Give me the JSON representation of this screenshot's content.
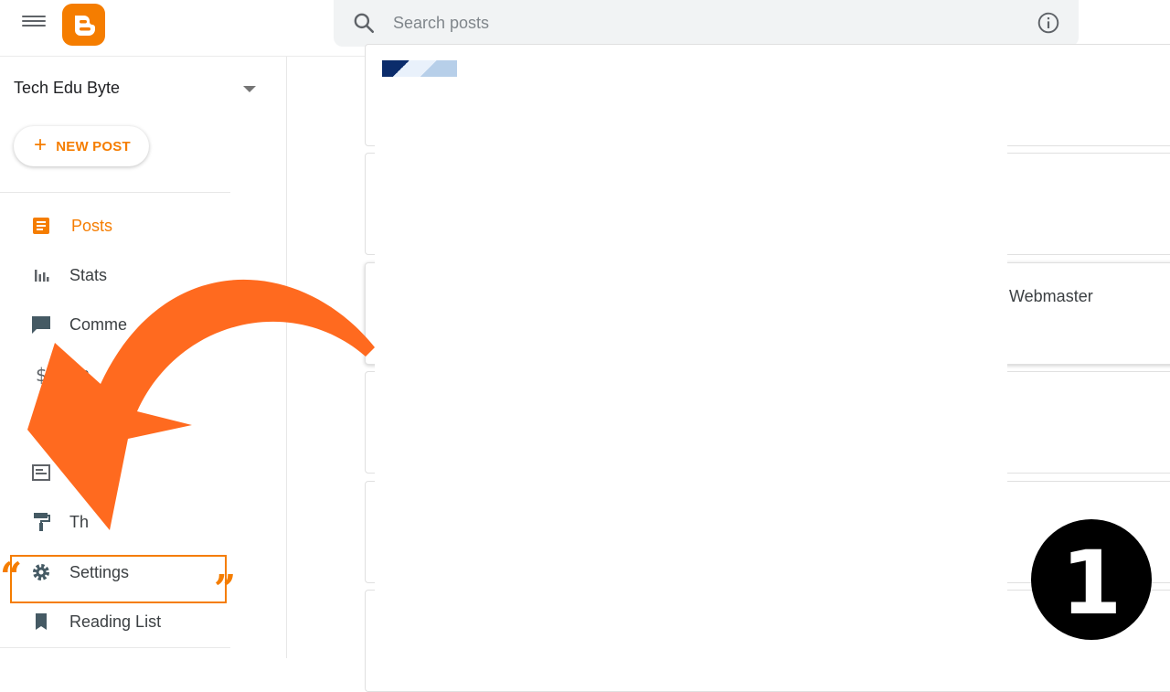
{
  "header": {
    "search_placeholder": "Search posts"
  },
  "sidebar": {
    "blog_name": "Tech Edu Byte",
    "new_post_label": "NEW POST",
    "items": [
      {
        "label": "Posts",
        "icon": "posts-icon",
        "active": true
      },
      {
        "label": "Stats",
        "icon": "stats-icon"
      },
      {
        "label": "Comme",
        "icon": "comments-icon"
      },
      {
        "label": "Ea",
        "icon": "dollar-icon"
      },
      {
        "label": "",
        "icon": "pages-icon"
      },
      {
        "label": "",
        "icon": "layout-icon"
      },
      {
        "label": "Th",
        "icon": "paint-roller-icon"
      },
      {
        "label": "Settings",
        "icon": "gear-icon"
      },
      {
        "label": "Reading List",
        "icon": "bookmark-icon"
      }
    ]
  },
  "main": {
    "post_author_fragment": "y Webmaster"
  },
  "overlay": {
    "step_number": "1",
    "accent_color": "#f57d00",
    "arrow_color": "#ff6a1f"
  }
}
